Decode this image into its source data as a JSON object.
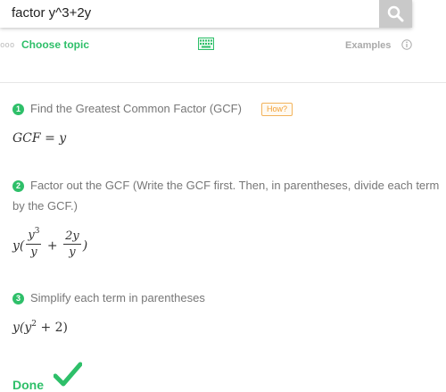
{
  "search": {
    "value": "factor y^3+2y",
    "button_icon": "search-icon"
  },
  "toolbar": {
    "dots": "ooo",
    "choose_topic": "Choose topic",
    "keyboard_icon": "keyboard-icon",
    "examples": "Examples",
    "info_icon": "info-icon"
  },
  "steps": [
    {
      "number": "1",
      "text": "Find the Greatest Common Factor (GCF)",
      "badge": "How?",
      "math": {
        "lhs": "GCF",
        "eq": "=",
        "rhs": "y"
      }
    },
    {
      "number": "2",
      "text": "Factor out the GCF (Write the GCF first. Then, in parentheses, divide each term by the GCF.)",
      "math": {
        "lead": "y(",
        "f1_num": "y",
        "f1_num_exp": "3",
        "f1_den": "y",
        "plus": "+",
        "f2_num": "2y",
        "f2_den": "y",
        "close": ")"
      }
    },
    {
      "number": "3",
      "text": "Simplify each term in parentheses",
      "math": {
        "base": "y(y",
        "exp": "2",
        "rest": " + 2)"
      }
    }
  ],
  "done": {
    "label": "Done",
    "icon": "checkmark-icon"
  },
  "colors": {
    "accent": "#2ebf69",
    "badge": "#f2a035",
    "button": "#c9c9c9"
  }
}
